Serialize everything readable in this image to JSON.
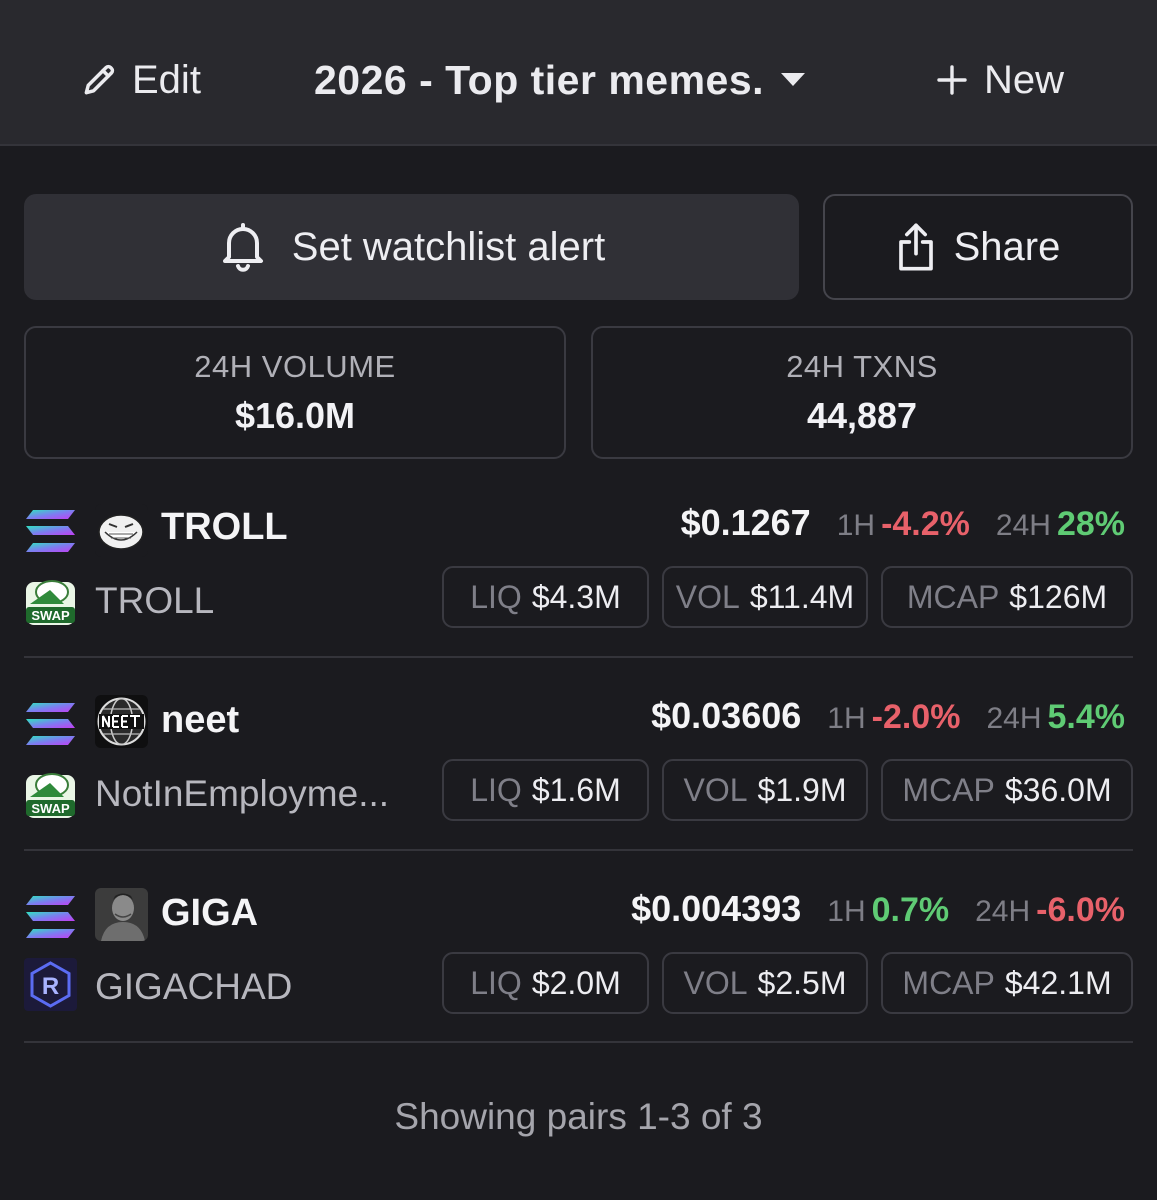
{
  "header": {
    "edit_label": "Edit",
    "watchlist_title": "2026 - Top tier memes.",
    "new_label": "New"
  },
  "actions": {
    "alert_label": "Set watchlist alert",
    "share_label": "Share"
  },
  "stats": {
    "volume_label": "24H VOLUME",
    "volume_value": "$16.0M",
    "txns_label": "24H TXNS",
    "txns_value": "44,887"
  },
  "labels": {
    "h1": "1H",
    "h24": "24H",
    "liq": "LIQ",
    "vol": "VOL",
    "mcap": "MCAP"
  },
  "pairs": [
    {
      "symbol": "TROLL",
      "name": "TROLL",
      "dex": "SWAP",
      "price": "$0.1267",
      "change_1h": "-4.2%",
      "change_24h": "28%",
      "liq": "$4.3M",
      "vol": "$11.4M",
      "mcap": "$126M"
    },
    {
      "symbol": "neet",
      "name": "NotInEmployme...",
      "dex": "SWAP",
      "price": "$0.03606",
      "change_1h": "-2.0%",
      "change_24h": "5.4%",
      "liq": "$1.6M",
      "vol": "$1.9M",
      "mcap": "$36.0M"
    },
    {
      "symbol": "GIGA",
      "name": "GIGACHAD",
      "dex": "R",
      "price": "$0.004393",
      "change_1h": "0.7%",
      "change_24h": "-6.0%",
      "liq": "$2.0M",
      "vol": "$2.5M",
      "mcap": "$42.1M"
    }
  ],
  "footer": "Showing pairs 1-3 of 3",
  "colors": {
    "positive": "#5fcb74",
    "negative": "#e8616a",
    "background": "#1b1b1f",
    "header_bg": "#29292e"
  }
}
